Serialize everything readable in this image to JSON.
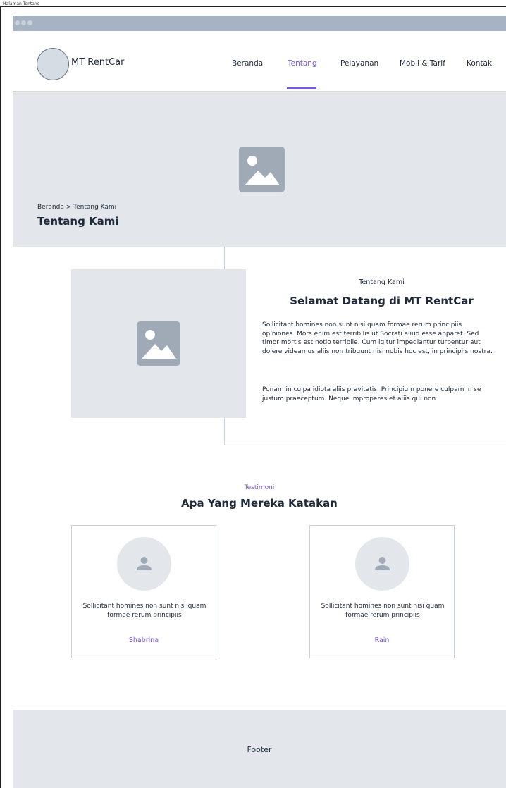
{
  "page_label": "Halaman Tentang",
  "brand": {
    "name": "MT RentCar"
  },
  "nav": {
    "items": [
      {
        "label": "Beranda",
        "active": false
      },
      {
        "label": "Tentang",
        "active": true
      },
      {
        "label": "Pelayanan",
        "active": false
      },
      {
        "label": "Mobil & Tarif",
        "active": false
      },
      {
        "label": "Kontak",
        "active": false
      }
    ],
    "accent_color": "#7656e0"
  },
  "hero": {
    "breadcrumb": "Beranda > Tentang Kami",
    "title": "Tentang Kami"
  },
  "about": {
    "eyebrow": "Tentang Kami",
    "title": "Selamat Datang di MT RentCar",
    "paragraph1": "Sollicitant homines non sunt nisi quam formae rerum principiis opiniones. Mors enim est terribilis ut Socrati aliud esse apparet. Sed timor mortis est notio terribile. Cum igitur impediantur turbentur aut dolere videamus aliis non tribuunt nisi nobis hoc est, in principiis nostra.",
    "paragraph2": "Ponam in culpa idiota aliis pravitatis. Principium ponere culpam in se justum praeceptum. Neque improperes et aliis qui non"
  },
  "testimonials": {
    "eyebrow": "Testimoni",
    "title": "Apa Yang Mereka Katakan",
    "items": [
      {
        "text": "Sollicitant homines non sunt nisi quam formae rerum principiis",
        "name": "Shabrina"
      },
      {
        "text": "Sollicitant homines non sunt nisi quam formae rerum principiis",
        "name": "Rain"
      }
    ]
  },
  "footer": {
    "label": "Footer"
  },
  "icons": {
    "hero_image": "image-placeholder-icon",
    "about_image": "image-placeholder-icon",
    "avatar": "user-icon"
  }
}
